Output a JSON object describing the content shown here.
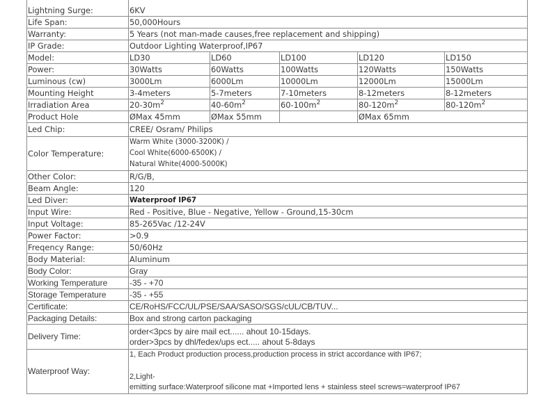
{
  "rows_top": [
    {
      "label": "Lightning Surge:",
      "value": "6KV"
    },
    {
      "label": "Life Span:",
      "value": "50,000Hours"
    },
    {
      "label": "Warranty:",
      "value": "5 Years (not man-made causes,free replacement and shipping)"
    },
    {
      "label": "IP Grade:",
      "value": "Outdoor Lighting Waterproof,IP67"
    }
  ],
  "models": {
    "model": {
      "label": "Model:",
      "values": [
        "LD30",
        "LD60",
        "LD100",
        "LD120",
        "LD150"
      ]
    },
    "power": {
      "label": "Power:",
      "values": [
        "30Watts",
        "60Watts",
        "100Watts",
        "120Watts",
        "150Watts"
      ]
    },
    "luminous": {
      "label": "Luminous (cw)",
      "values": [
        "3000Lm",
        "6000Lm",
        "10000Lm",
        "12000Lm",
        "15000Lm"
      ]
    },
    "mounting": {
      "label": "Mounting Height",
      "values": [
        "3-4meters",
        "5-7meters",
        "7-10meters",
        "8-12meters",
        "8-12meters"
      ]
    },
    "irradiation": {
      "label": "Irradiation Area",
      "values": [
        "20-30m",
        "40-60m",
        "60-100m",
        "80-120m",
        "80-120m"
      ],
      "unit_sup": "2"
    },
    "hole": {
      "label": "Product Hole",
      "values": [
        "ØMax 45mm",
        "ØMax 55mm",
        "",
        "ØMax 65mm"
      ]
    }
  },
  "led_chip": {
    "label": "Led Chip:",
    "value": "CREE/ Osram/ Philips"
  },
  "color_temp": {
    "label": "Color Temperature:",
    "lines": [
      "Warm White (3000-3200K) /",
      "Cool White(6000-6500K) /",
      "Natural White(4000-5000K)"
    ]
  },
  "rows_mid": [
    {
      "label": "Other Color:",
      "value": " R/G/B,"
    },
    {
      "label": "Beam Angle:",
      "value": "120"
    },
    {
      "label": "Led Diver:",
      "value": "Waterproof IP67"
    },
    {
      "label": "Input Wire:",
      "value": "Red - Positive, Blue - Negative, Yellow - Ground,15-30cm"
    },
    {
      "label": "Input Voltage:",
      "value": "85-265Vac /12-24V"
    },
    {
      "label": "Power Factor:",
      "value": ">0.9"
    },
    {
      "label": "Freqency Range:",
      "value": "50/60Hz"
    },
    {
      "label": "Body Material:",
      "value": "Aluminum"
    }
  ],
  "rows_bottom": [
    {
      "label": "Body Color:",
      "value": "Gray"
    },
    {
      "label": "Working Temperature",
      "value": "-35 - +70"
    },
    {
      "label": "Storage Temperature",
      "value": "-35 - +55"
    },
    {
      "label": "Certificate:",
      "value": "CE/RoHS/FCC/UL/PSE/SAA/SASO/SGS/cUL/CB/TUV..."
    },
    {
      "label": "Packaging Details:",
      "value": "Box and strong carton packaging"
    }
  ],
  "delivery": {
    "label": "Delivery Time:",
    "lines": [
      "order<3pcs by aire mail ect...... ahout 10-15days.",
      "order>3pcs by dhl/fedex/ups ect..... ahout 5-8days"
    ]
  },
  "waterproof": {
    "label": "Waterproof Way:",
    "lines": [
      "1, Each Product production process,production process in strict accordance with IP67;",
      "2,Light-",
      "emitting surface:Waterproof silicone mat +Imported lens + stainless steel screws=waterproof IP67"
    ]
  }
}
